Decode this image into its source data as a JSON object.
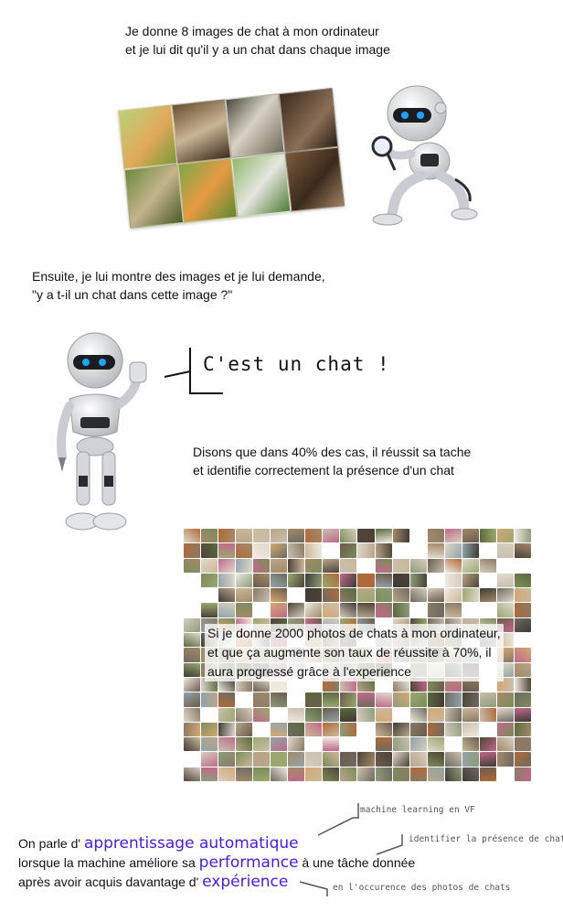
{
  "intro": {
    "line1": "Je donne 8 images de chat à mon ordinateur",
    "line2": "et je lui dit qu'il y a un chat dans chaque image"
  },
  "question": {
    "line1": "Ensuite, je lui montre des images et je lui demande,",
    "line2": "\"y a t-il un chat dans cette image ?\""
  },
  "speech": "C'est un chat !",
  "success": {
    "line1": "Disons que dans 40% des cas, il réussit sa tache",
    "line2": "et identifie correctement la présence d'un chat"
  },
  "experience": {
    "line1": "Si je donne 2000 photos de chats à mon ordinateur,",
    "line2": "et que ça augmente son taux de réussite à 70%, il",
    "line3": "aura progressé grâce à l'experience"
  },
  "definition": {
    "prefix1": "On parle d'",
    "term1": "apprentissage automatique",
    "prefix2": "lorsque  la machine améliore sa",
    "term2": "performance",
    "suffix2": "à une tâche donnée",
    "prefix3": "après avoir acquis davantage d'",
    "term3": "expérience"
  },
  "notes": {
    "n1": "machine learning en VF",
    "n2": "identifier la présence de chats",
    "n3": "en l'occurence des photos de chats"
  },
  "colors": {
    "highlight": "#4b1cd6",
    "robot_eye": "#1fa3ff"
  }
}
